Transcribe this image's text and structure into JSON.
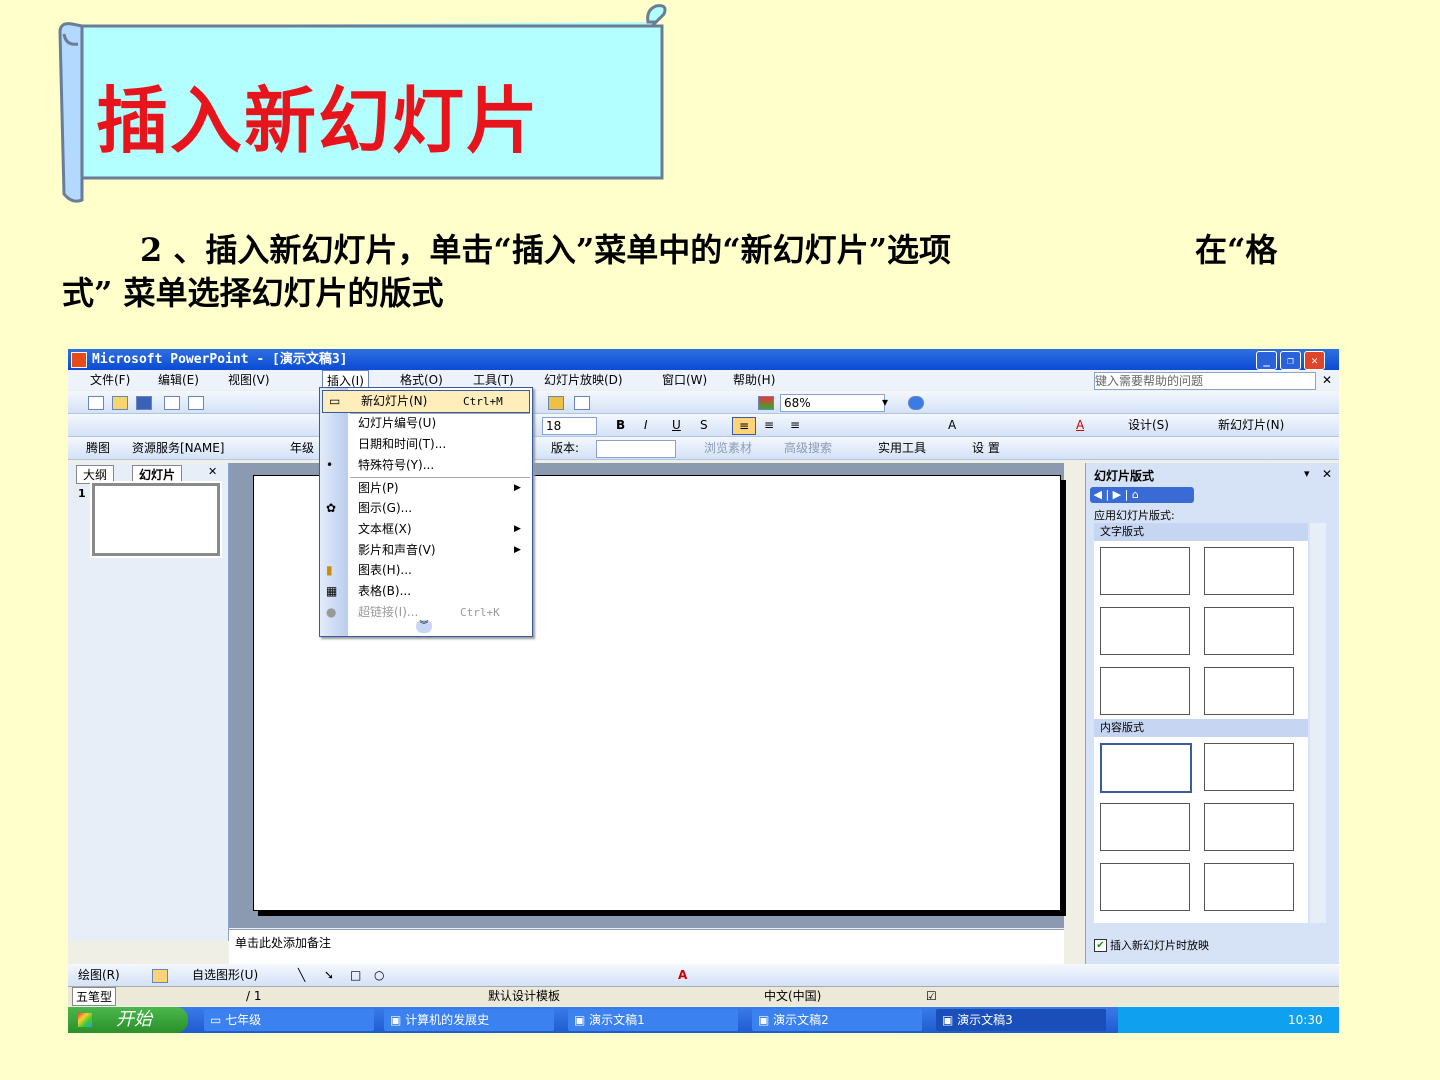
{
  "slide": {
    "title": "插入新幻灯片",
    "instruction_line1": "2 、插入新幻灯片，单击“插入”菜单中的“新幻灯片”选项",
    "instruction_line1b": "在“格",
    "instruction_line2": "式” 菜单选择幻灯片的版式"
  },
  "app": {
    "title": "Microsoft PowerPoint - [演示文稿3]",
    "help_placeholder": "键入需要帮助的问题",
    "menu": [
      "文件(F)",
      "编辑(E)",
      "视图(V)",
      "插入(I)",
      "格式(O)",
      "工具(T)",
      "幻灯片放映(D)",
      "窗口(W)",
      "帮助(H)"
    ],
    "zoom": "68%",
    "font_size": "18",
    "toolbar2": {
      "design": "设计(S)",
      "new_slide": "新幻灯片(N)"
    },
    "toolbar3": {
      "tengtu": "腾图",
      "resource": "资源服务[NAME]",
      "grade": "年级",
      "version": "版本:",
      "browse": "浏览素材",
      "search": "高级搜索",
      "tools": "实用工具",
      "setup": "设 置"
    },
    "tabs": {
      "outline": "大纲",
      "slides": "幻灯片"
    },
    "slide_number": "1",
    "notes_placeholder": "单击此处添加备注"
  },
  "insert_menu": {
    "items": [
      {
        "label": "新幻灯片(N)",
        "shortcut": "Ctrl+M",
        "highlighted": true
      },
      {
        "label": "幻灯片编号(U)"
      },
      {
        "label": "日期和时间(T)..."
      },
      {
        "label": "特殊符号(Y)..."
      },
      {
        "label": "图片(P)",
        "submenu": true
      },
      {
        "label": "图示(G)..."
      },
      {
        "label": "文本框(X)",
        "submenu": true
      },
      {
        "label": "影片和声音(V)",
        "submenu": true
      },
      {
        "label": "图表(H)..."
      },
      {
        "label": "表格(B)..."
      },
      {
        "label": "超链接(I)...",
        "shortcut": "Ctrl+K",
        "disabled": true
      }
    ]
  },
  "taskpane": {
    "title": "幻灯片版式",
    "apply_label": "应用幻灯片版式:",
    "text_layouts": "文字版式",
    "content_layouts": "内容版式",
    "checkbox": "插入新幻灯片时放映"
  },
  "drawbar": {
    "draw": "绘图(R)",
    "autoshapes": "自选图形(U)"
  },
  "status": {
    "ime": "五笔型",
    "page": "/ 1",
    "template": "默认设计模板",
    "lang": "中文(中国)"
  },
  "taskbar": {
    "start": "开始",
    "tasks": [
      "七年级",
      "计算机的发展史",
      "演示文稿1",
      "演示文稿2",
      "演示文稿3"
    ],
    "clock": "10:30"
  }
}
